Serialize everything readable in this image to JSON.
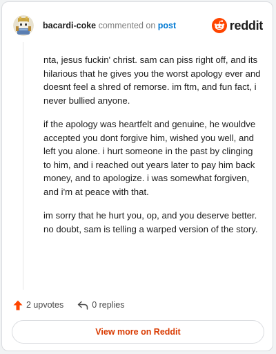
{
  "comment": {
    "username": "bacardi-coke",
    "verb": "commented on",
    "post_link": "post",
    "paragraphs": [
      "nta, jesus fuckin' christ. sam can piss right off, and its hilarious that he gives you the worst apology ever and doesnt feel a shred of remorse. im ftm, and fun fact, i never bullied anyone.",
      "if the apology was heartfelt and genuine, he wouldve accepted you dont forgive him, wished you well, and left you alone. i hurt someone in the past by clinging to him, and i reached out years later to pay him back money, and to apologize. i was somewhat forgiven, and i'm at peace with that.",
      "im sorry that he hurt you, op, and you deserve better. no doubt, sam is telling a warped version of the story."
    ]
  },
  "brand": {
    "wordmark": "reddit",
    "icon": "reddit-snoo-icon",
    "color": "#ff4500"
  },
  "actions": {
    "upvotes_label": "2 upvotes",
    "replies_label": "0 replies",
    "upvote_icon": "upvote-arrow-icon",
    "reply_icon": "reply-arrow-icon",
    "upvote_color": "#ff4500"
  },
  "footer": {
    "button_label": "View more on Reddit",
    "button_color": "#d93a00"
  },
  "colors": {
    "link": "#0079d3",
    "text": "#1c1c1c",
    "muted": "#7c7c7c"
  }
}
